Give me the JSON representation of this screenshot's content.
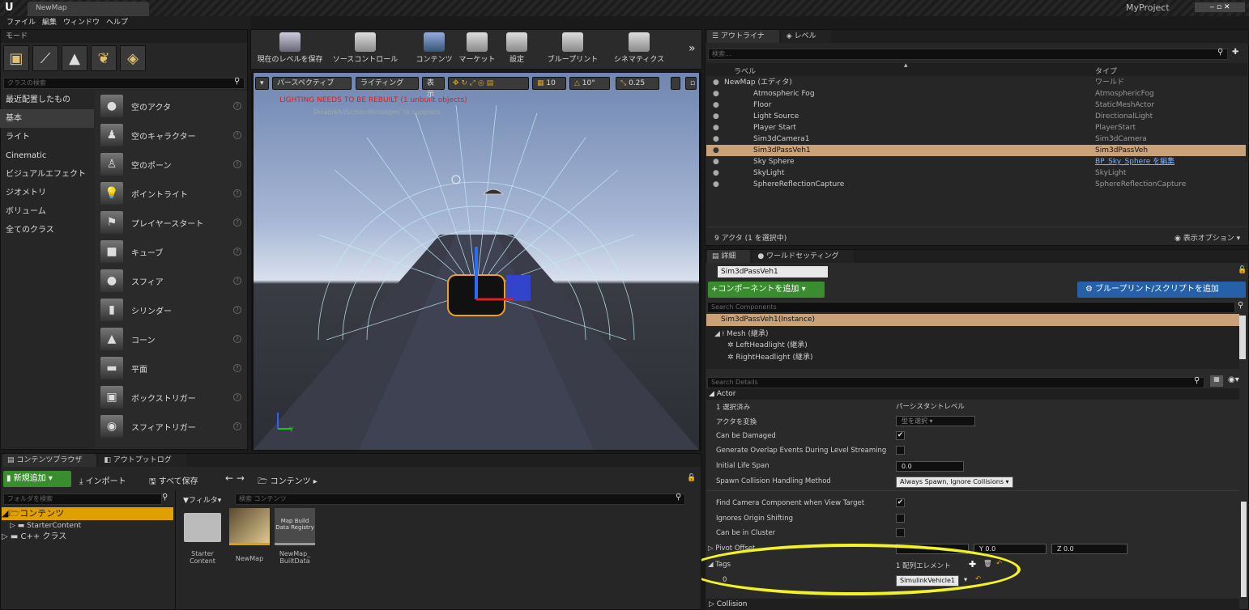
{
  "titlebar": {
    "app_logo": "U",
    "tab_title": "NewMap",
    "project": "MyProject"
  },
  "menu": [
    "ファイル",
    "編集",
    "ウィンドウ",
    "ヘルプ"
  ],
  "modes": {
    "tab": "モード",
    "search_placeholder": "クラスの検索",
    "categories": [
      "最近配置したもの",
      "基本",
      "ライト",
      "Cinematic",
      "ビジュアルエフェクト",
      "ジオメトリ",
      "ボリューム",
      "全てのクラス"
    ],
    "selected_category": "基本",
    "actors": [
      "空のアクタ",
      "空のキャラクター",
      "空のポーン",
      "ポイントライト",
      "プレイヤースタート",
      "キューブ",
      "スフィア",
      "シリンダー",
      "コーン",
      "平面",
      "ボックストリガー",
      "スフィアトリガー"
    ]
  },
  "toolbar": {
    "buttons": [
      "現在のレベルを保存",
      "ソースコントロール",
      "コンテンツ",
      "マーケット",
      "設定",
      "ブループリント",
      "シネマティクス"
    ],
    "overflow": "»"
  },
  "viewport": {
    "perspective": "パースペクティブ",
    "lighting": "ライティング",
    "show": "表示",
    "grid": "10",
    "angle": "10°",
    "scale": "0.25",
    "warning": "LIGHTING NEEDS TO BE REBUILT (1 unbuilt objects)",
    "warning_sub": "DisableAllScreenMessages' to suppress",
    "axis_y": "Y"
  },
  "outliner": {
    "tabs": [
      "アウトライナ",
      "レベル"
    ],
    "search_placeholder": "検索...",
    "col_label": "ラベル",
    "col_type": "タイプ",
    "rows": [
      {
        "label": "NewMap (エディタ)",
        "type": "ワールド"
      },
      {
        "label": "Atmospheric Fog",
        "type": "AtmosphericFog"
      },
      {
        "label": "Floor",
        "type": "StaticMeshActor"
      },
      {
        "label": "Light Source",
        "type": "DirectionalLight"
      },
      {
        "label": "Player Start",
        "type": "PlayerStart"
      },
      {
        "label": "Sim3dCamera1",
        "type": "Sim3dCamera"
      },
      {
        "label": "Sim3dPassVeh1",
        "type": "Sim3dPassVeh"
      },
      {
        "label": "Sky Sphere",
        "type": "BP_Sky_Sphere を編集"
      },
      {
        "label": "SkyLight",
        "type": "SkyLight"
      },
      {
        "label": "SphereReflectionCapture",
        "type": "SphereReflectionCapture"
      }
    ],
    "selected_index": 6,
    "footer_count": "9 アクタ (1 を選択中)",
    "view_options": "表示オプション"
  },
  "details": {
    "tabs": [
      "詳細",
      "ワールドセッティング"
    ],
    "actor_name": "Sim3dPassVeh1",
    "add_component": "+コンポーネントを追加",
    "blueprint_button": "ブループリント/スクリプトを追加",
    "search_components": "Search Components",
    "components": [
      "Sim3dPassVeh1(Instance)",
      "Mesh (継承)",
      "LeftHeadlight (継承)",
      "RightHeadlight (継承)"
    ],
    "search_details": "Search Details",
    "section_actor": "Actor",
    "props": [
      {
        "k": "1 選択済み",
        "v": "パーシスタントレベル"
      },
      {
        "k": "アクタを変換",
        "v": "型を選択"
      },
      {
        "k": "Can be Damaged",
        "v": "✔"
      },
      {
        "k": "Generate Overlap Events During Level Streaming",
        "v": ""
      },
      {
        "k": "Initial Life Span",
        "v": "0.0"
      },
      {
        "k": "Spawn Collision Handling Method",
        "v": "Always Spawn, Ignore Collisions"
      },
      {
        "k": "Find Camera Component when View Target",
        "v": "✔"
      },
      {
        "k": "Ignores Origin Shifting",
        "v": ""
      },
      {
        "k": "Can be in Cluster",
        "v": ""
      }
    ],
    "pivot_label": "Pivot Offset",
    "pivot_y": "Y  0.0",
    "pivot_z": "Z  0.0",
    "tags_label": "Tags",
    "tags_value": "1 配列エレメント",
    "tag_index": "0",
    "tag_0": "SimulinkVehicle1",
    "section_collision": "Collision"
  },
  "content_browser": {
    "tabs": [
      "コンテンツブラウザ",
      "アウトプットログ"
    ],
    "add_new": "新規追加",
    "import": "インポート",
    "save_all": "すべて保存",
    "path": "コンテンツ",
    "folder_search": "フォルダを検索",
    "filter": "フィルタ",
    "content_search": "検索 コンテンツ",
    "tree": [
      "コンテンツ",
      "StarterContent",
      "C++ クラス"
    ],
    "assets": [
      {
        "name": "Starter\nContent",
        "thumb": ""
      },
      {
        "name": "NewMap",
        "thumb": ""
      },
      {
        "name": "NewMap_\nBuiltData",
        "thumb": "Map Build\nData Registry"
      }
    ]
  }
}
